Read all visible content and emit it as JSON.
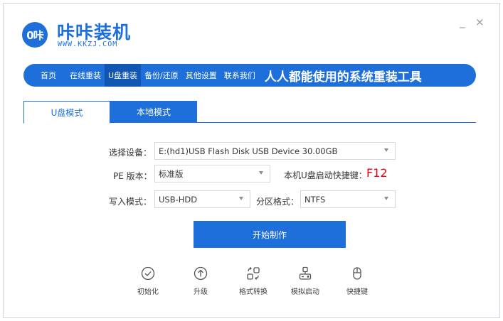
{
  "app": {
    "logo_text": "0咔",
    "name": "咔咔装机",
    "url_text": "WWW.KKZJ.COM",
    "minimize": "_",
    "close": "×",
    "accent_color": "#1e6fd9"
  },
  "nav": {
    "items": [
      {
        "label": "首页"
      },
      {
        "label": "在线重装"
      },
      {
        "label": "U盘重装"
      },
      {
        "label": "备份/还原"
      },
      {
        "label": "其他设置"
      },
      {
        "label": "联系我们"
      }
    ],
    "active_index": 2,
    "slogan": "人人都能使用的系统重装工具"
  },
  "tabs": [
    {
      "label": "U盘模式"
    },
    {
      "label": "本地模式"
    }
  ],
  "form": {
    "device_label": "选择设备：",
    "device_value": "E:(hd1)USB Flash Disk USB Device 30.00GB",
    "pe_label": "PE 版本：",
    "pe_value": "标准版",
    "hotkey_label": "本机U盘启动快捷键：",
    "hotkey_value": "F12",
    "write_label": "写入模式：",
    "write_value": "USB-HDD",
    "partition_label": "分区格式：",
    "partition_value": "NTFS"
  },
  "start_button": "开始制作",
  "tools": [
    {
      "label": "初始化",
      "icon": "check-circle-icon"
    },
    {
      "label": "升级",
      "icon": "upgrade-arrow-icon"
    },
    {
      "label": "格式转换",
      "icon": "format-convert-icon"
    },
    {
      "label": "模拟启动",
      "icon": "simulate-boot-icon"
    },
    {
      "label": "快捷键",
      "icon": "mouse-icon"
    }
  ]
}
